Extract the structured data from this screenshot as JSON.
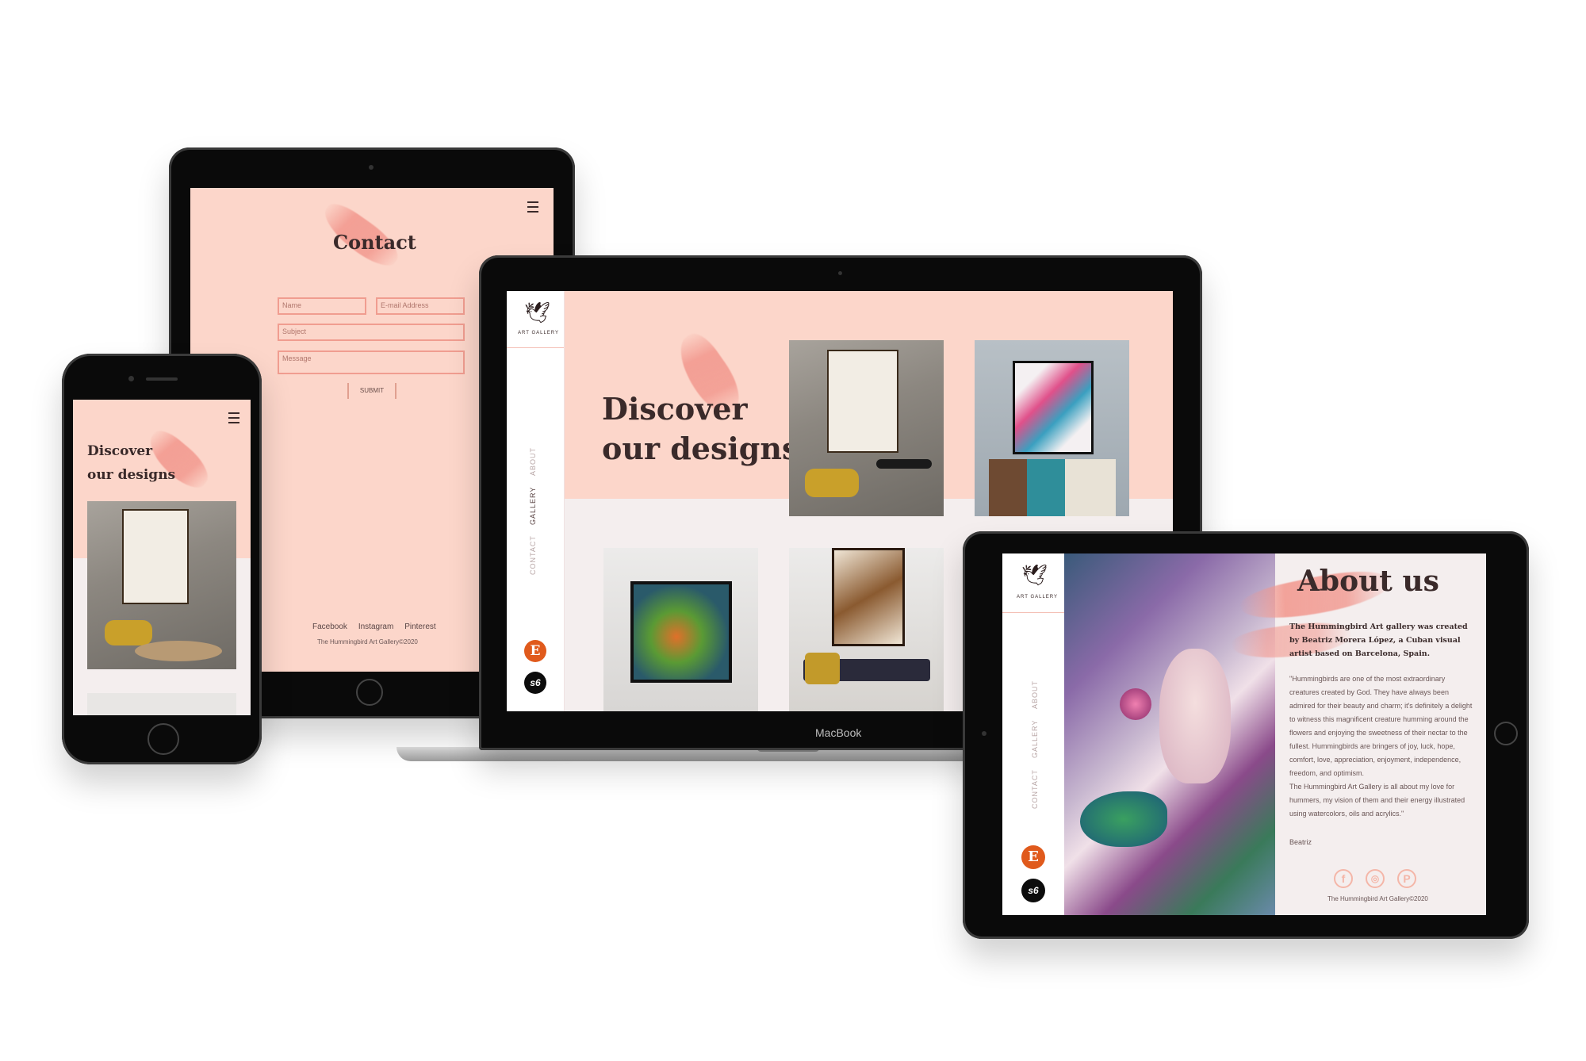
{
  "contact_tablet": {
    "title": "Contact",
    "fields": {
      "name": "Name",
      "email": "E-mail Address",
      "subject": "Subject",
      "message": "Message"
    },
    "submit_label": "SUBMIT",
    "footer_links": [
      "Facebook",
      "Instagram",
      "Pinterest"
    ],
    "copyright": "The Hummingbird Art Gallery©2020"
  },
  "phone": {
    "headline_line1": "Discover",
    "headline_line2": "our designs"
  },
  "laptop": {
    "brand_label": "ART GALLERY",
    "nav": [
      "ABOUT",
      "GALLERY",
      "CONTACT"
    ],
    "headline_line1": "Discover",
    "headline_line2": "our designs",
    "etsy_label": "E",
    "s6_label": "s6",
    "device_label": "MacBook"
  },
  "about_tablet": {
    "brand_label": "ART GALLERY",
    "nav": [
      "ABOUT",
      "GALLERY",
      "CONTACT"
    ],
    "title": "About us",
    "intro": "The Hummingbird Art gallery was created by Beatriz Morera López, a Cuban visual artist based on Barcelona, Spain.",
    "body": "\"Hummingbirds are one of the most extraordinary creatures created by God. They have always been admired for their beauty and charm; it's definitely a delight to witness this magnificent creature humming around the flowers and enjoying the sweetness of their nectar to the fullest. Hummingbirds are bringers of joy, luck, hope, comfort, love, appreciation, enjoyment, independence, freedom, and optimism.\nThe Hummingbird Art Gallery is all about my love for hummers, my vision of them and their energy illustrated using watercolors, oils and acrylics.\"",
    "signature": "Beatriz",
    "social_icons": [
      "facebook-icon",
      "instagram-icon",
      "pinterest-icon"
    ],
    "social_glyphs": [
      "f",
      "◎",
      "P"
    ],
    "etsy_label": "E",
    "s6_label": "s6",
    "copyright": "The Hummingbird Art Gallery©2020"
  },
  "colors": {
    "pink": "#fcd6ca",
    "brush": "#f0968c",
    "text": "#3a2a2a",
    "etsy": "#e05a1c"
  }
}
